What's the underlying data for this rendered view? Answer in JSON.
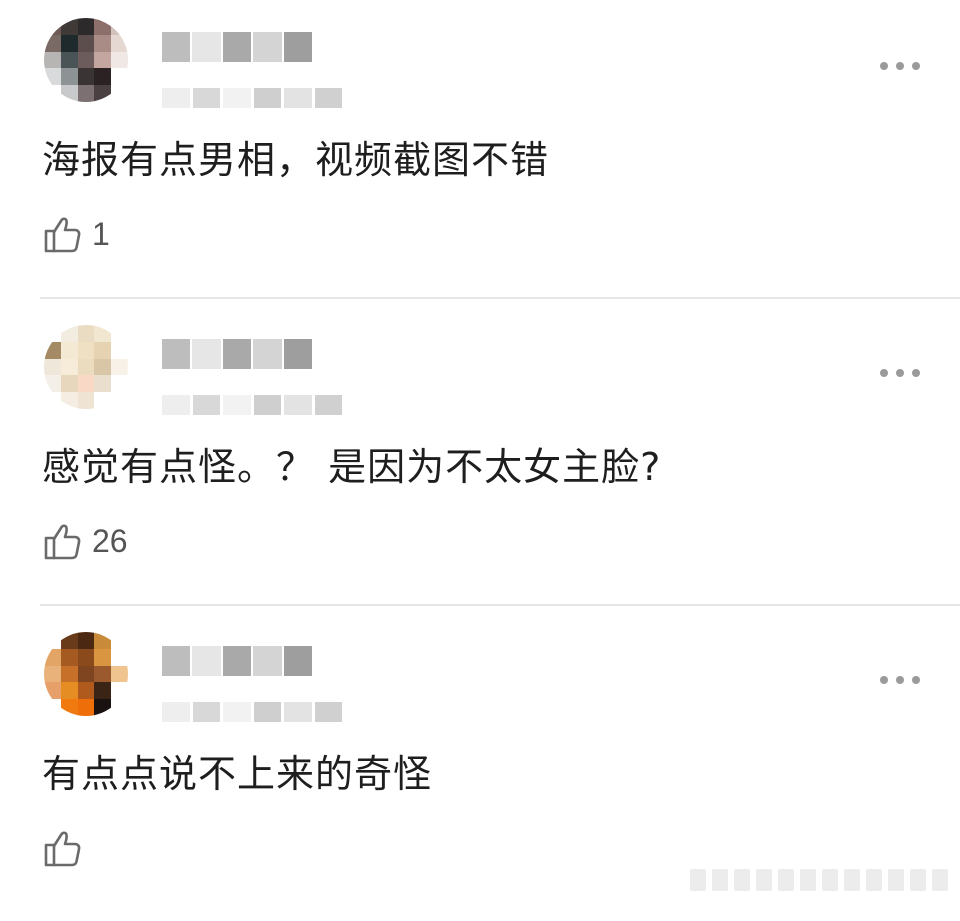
{
  "comments": [
    {
      "text": "海报有点男相，视频截图不错",
      "likes": "1",
      "avatar_icon": "pixelated-avatar",
      "avatar_palette": [
        "#6e5b55",
        "#3f3a38",
        "#2c2a2b",
        "#8c6f6a",
        "#d2c2bc",
        "#7a6a66",
        "#1f2a2c",
        "#5b4e4c",
        "#a98c86",
        "#e5d8d2",
        "#b7b5b3",
        "#4a5356",
        "#6c5c5c",
        "#c3a6a0",
        "#efe8e4",
        "#d9dadc",
        "#8d9294",
        "#3b3434",
        "#2b2223",
        "#ffffff",
        "#ffffff",
        "#c7c9cb",
        "#7c7072",
        "#4a3f41",
        "#ffffff"
      ]
    },
    {
      "text": "感觉有点怪。？ 是因为不太女主脸?",
      "likes": "26",
      "avatar_icon": "pixelated-avatar",
      "avatar_palette": [
        "#ffffff",
        "#f3ece0",
        "#e9dcc2",
        "#f1e6cf",
        "#ffffff",
        "#a58a66",
        "#f4e9d3",
        "#efe0c4",
        "#e6d3b2",
        "#ffffff",
        "#efe7da",
        "#f6ecd9",
        "#ecdcbf",
        "#d9c6a6",
        "#f7f1e7",
        "#f4efe8",
        "#e7d7bd",
        "#f9d9c5",
        "#eadfcf",
        "#ffffff",
        "#ffffff",
        "#f5ede2",
        "#efe4d4",
        "#ffffff",
        "#ffffff"
      ]
    },
    {
      "text": "有点点说不上来的奇怪",
      "likes": "",
      "avatar_icon": "pixelated-avatar",
      "avatar_palette": [
        "#ffffff",
        "#6a3b1a",
        "#4a2812",
        "#c98a3a",
        "#ffffff",
        "#e2a566",
        "#a55a22",
        "#8a4a1c",
        "#d9953f",
        "#ffffff",
        "#e8b27a",
        "#c7702a",
        "#7e4520",
        "#9a5a2e",
        "#f0c48f",
        "#e8a06a",
        "#e58c22",
        "#b05a1e",
        "#3a2416",
        "#ffffff",
        "#ffffff",
        "#f07a10",
        "#ee6f0a",
        "#1a1210",
        "#ffffff"
      ]
    }
  ],
  "blur_colors": {
    "name": [
      "#bdbdbd",
      "#e6e6e6",
      "#a9a9a9",
      "#d4d4d4",
      "#9e9e9e"
    ],
    "meta": [
      "#eeeeee",
      "#d8d8d8",
      "#f2f2f2",
      "#cfcfcf",
      "#e3e3e3",
      "#d0d0d0"
    ]
  },
  "icons": {
    "more": "more-dots-icon",
    "like": "thumbs-up-icon"
  }
}
